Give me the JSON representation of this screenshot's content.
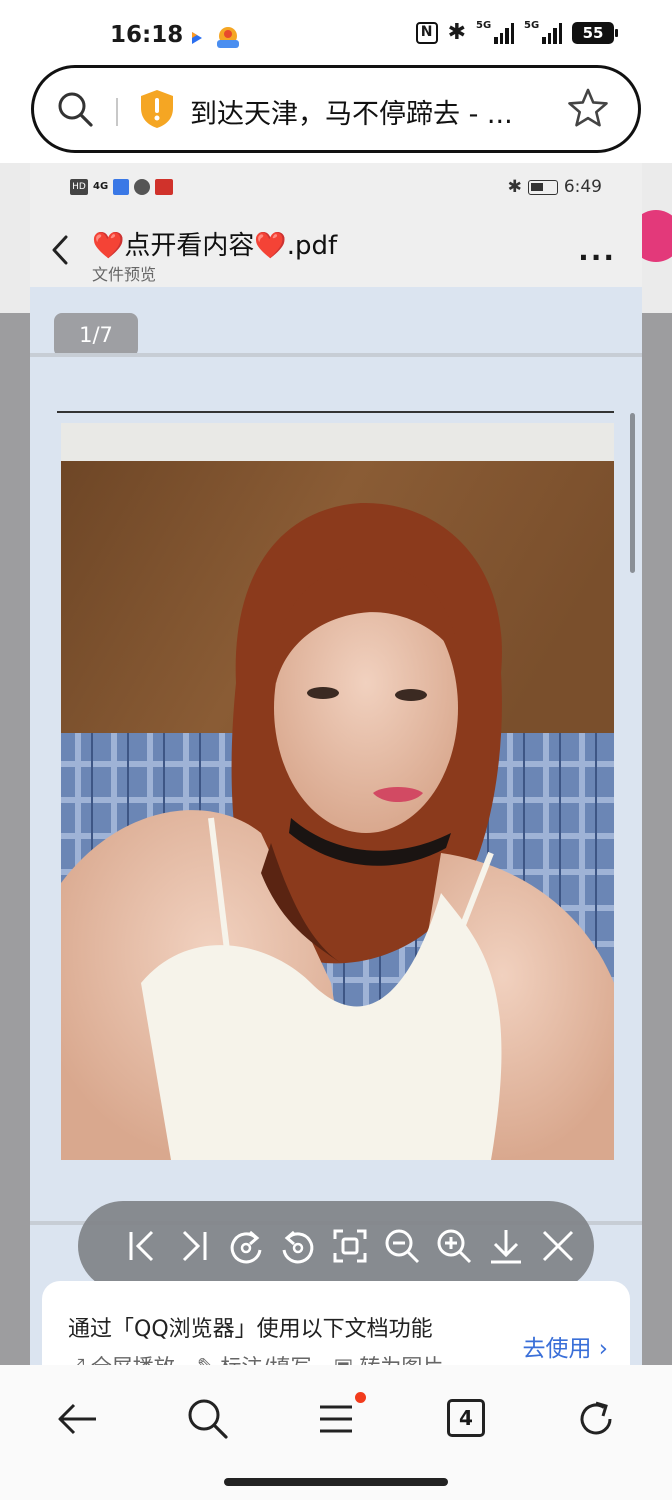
{
  "status_bar": {
    "time": "16:18",
    "nfc": "N",
    "signal1_tag": "5G",
    "signal2_tag": "5G",
    "battery": "55"
  },
  "url_bar": {
    "title": "到达天津，马不停蹄去 - ..."
  },
  "embedded": {
    "status": {
      "network": "4G",
      "time": "6:49"
    },
    "header": {
      "file_title": "❤️点开看内容❤️.pdf",
      "subtitle": "文件预览",
      "more": "···"
    },
    "page_counter": "1/7",
    "banner": {
      "text": "通过「QQ浏览器」使用以下文档功能",
      "link": "去使用 ›",
      "features": [
        "全屏播放",
        "标注/填写",
        "转为图片"
      ]
    }
  },
  "bottom_nav": {
    "tab_count": "4"
  },
  "colors": {
    "accent_link": "#3a6fd8",
    "shield": "#f5a623",
    "notification_dot": "#f23b1c",
    "doc_background": "#dbe4f0"
  },
  "icons": [
    "search-icon",
    "shield-icon",
    "star-icon",
    "back-icon",
    "more-icon",
    "first-page-icon",
    "last-page-icon",
    "rotate-left-icon",
    "rotate-right-icon",
    "fit-screen-icon",
    "zoom-out-icon",
    "zoom-in-icon",
    "download-icon",
    "close-icon",
    "arrow-back-icon",
    "menu-icon",
    "tabs-icon",
    "refresh-icon"
  ]
}
